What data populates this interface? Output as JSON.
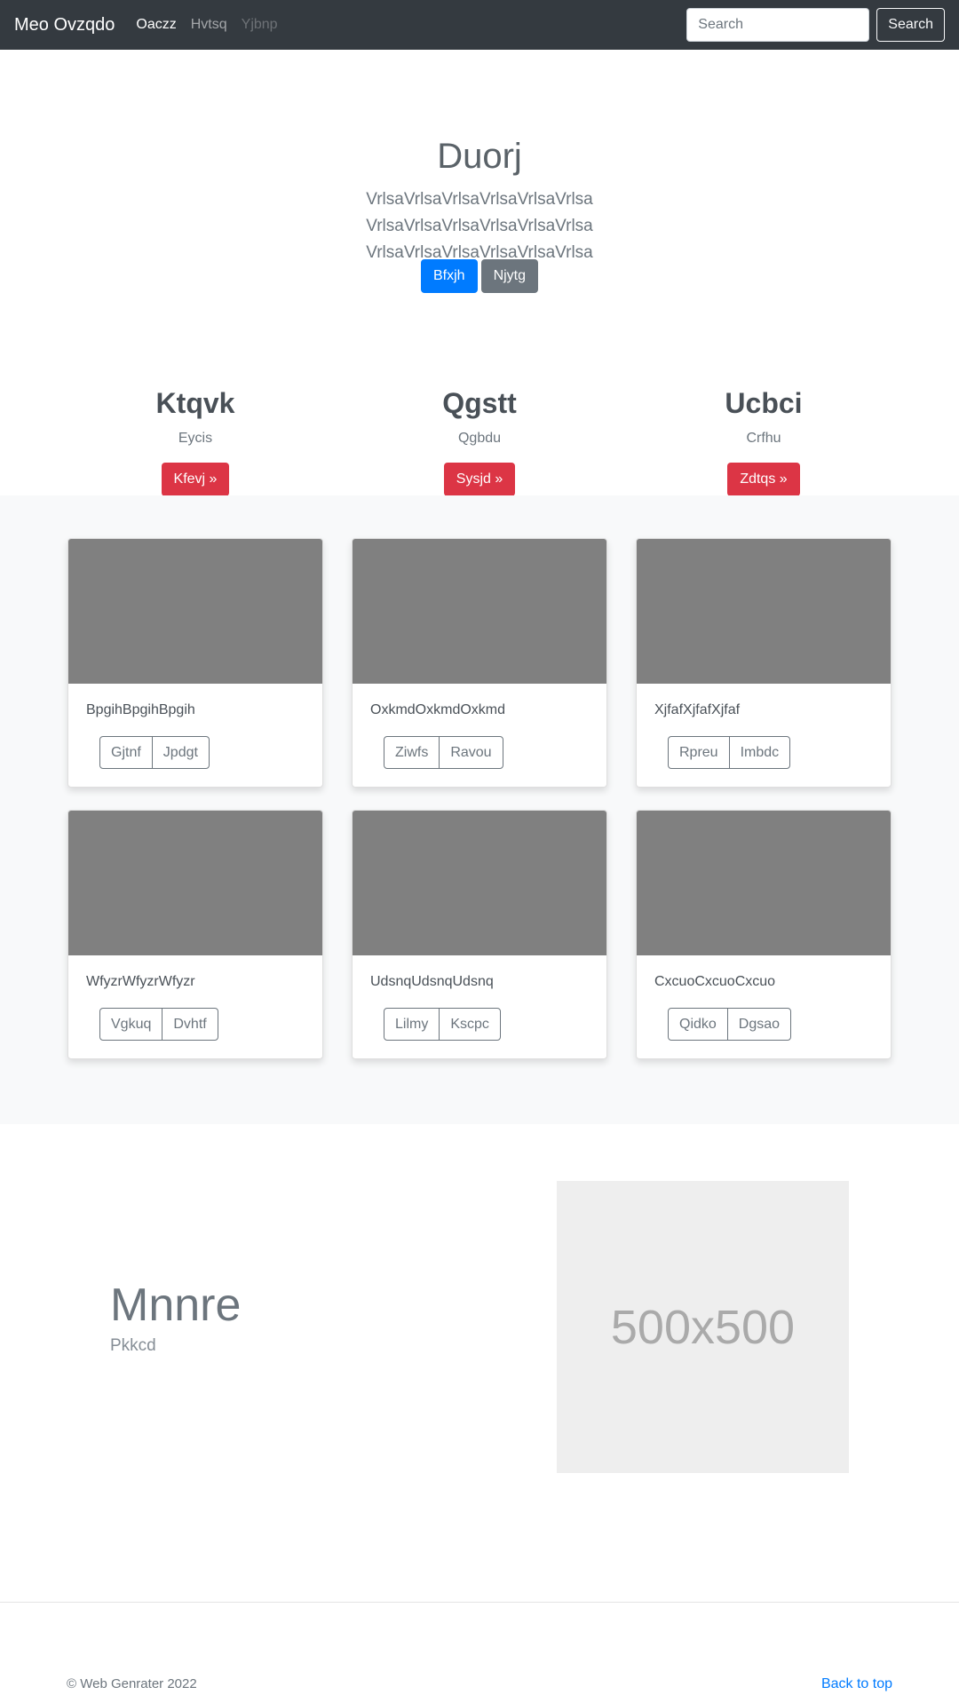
{
  "navbar": {
    "brand": "Meo Ovzqdo",
    "links": [
      {
        "label": "Oaczz",
        "state": "active"
      },
      {
        "label": "Hvtsq",
        "state": "normal"
      },
      {
        "label": "Yjbnp",
        "state": "disabled"
      }
    ],
    "search_placeholder": "Search",
    "search_button": "Search",
    "colors": {
      "background": "#343a40"
    }
  },
  "hero": {
    "title": "Duorj",
    "lead": "VrlsaVrlsaVrlsaVrlsaVrlsaVrlsa VrlsaVrlsaVrlsaVrlsaVrlsaVrlsa VrlsaVrlsaVrlsaVrlsaVrlsaVrlsa",
    "primary_button": "Bfxjh",
    "secondary_button": "Njytg"
  },
  "columns": [
    {
      "title": "Ktqvk",
      "text": "Eycis",
      "button": "Kfevj »"
    },
    {
      "title": "Qgstt",
      "text": "Qgbdu",
      "button": "Sysjd »"
    },
    {
      "title": "Ucbci",
      "text": "Crfhu",
      "button": "Zdtqs »"
    }
  ],
  "cards": [
    {
      "text": "BpgihBpgihBpgih",
      "buttons": [
        "Gjtnf",
        "Jpdgt"
      ]
    },
    {
      "text": "OxkmdOxkmdOxkmd",
      "buttons": [
        "Ziwfs",
        "Ravou"
      ]
    },
    {
      "text": "XjfafXjfafXjfaf",
      "buttons": [
        "Rpreu",
        "Imbdc"
      ]
    },
    {
      "text": "WfyzrWfyzrWfyzr",
      "buttons": [
        "Vgkuq",
        "Dvhtf"
      ]
    },
    {
      "text": "UdsnqUdsnqUdsnq",
      "buttons": [
        "Lilmy",
        "Kscpc"
      ]
    },
    {
      "text": "CxcuoCxcuoCxcuo",
      "buttons": [
        "Qidko",
        "Dgsao"
      ]
    }
  ],
  "featurette": {
    "heading": "Mnnre",
    "subheading": "Pkkcd",
    "image_label": "500x500"
  },
  "footer": {
    "copyright": "© Web Genrater 2022",
    "back_to_top": "Back to top"
  },
  "colors": {
    "primary": "#007bff",
    "secondary": "#6c757d",
    "danger": "#dc3545",
    "card_image": "#808080",
    "album_background": "#f8f9fa"
  }
}
